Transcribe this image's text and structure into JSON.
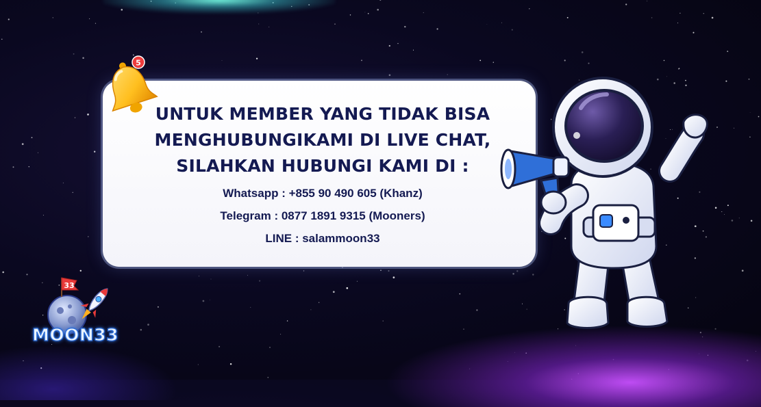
{
  "notification": {
    "badge_count": "5",
    "headline": [
      "UNTUK MEMBER YANG TIDAK BISA",
      "MENGHUBUNGIKAMI DI LIVE CHAT,",
      "SILAHKAN HUBUNGI KAMI DI :"
    ],
    "contacts": [
      "Whatsapp : +855 90 490 605 (Khanz)",
      "Telegram : 0877 1891 9315 (Mooners)",
      "LINE : salammoon33"
    ]
  },
  "brand": {
    "name": "MOON33",
    "flag_number": "33"
  },
  "icons": {
    "bell": "bell-icon",
    "astronaut": "astronaut-illustration",
    "megaphone": "megaphone-icon",
    "rocket": "rocket-icon"
  },
  "colors": {
    "text_dark": "#141a52",
    "accent_blue": "#2a6bd6",
    "glow_purple": "#c850ff",
    "glow_teal": "#78ffe6"
  }
}
